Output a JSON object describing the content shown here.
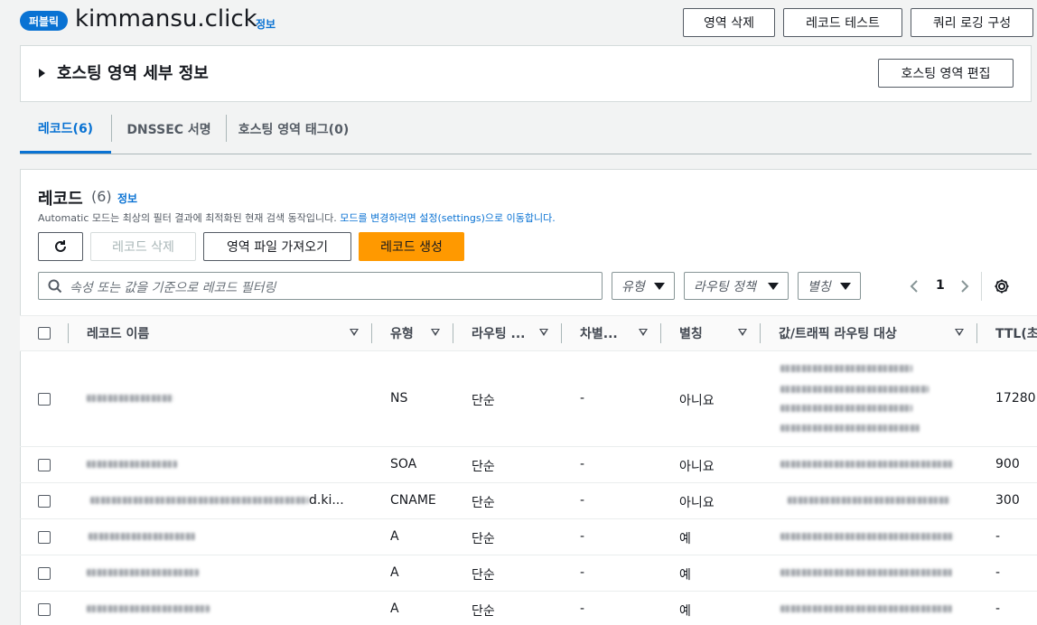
{
  "header": {
    "badge": "퍼블릭",
    "title": "kimmansu.click",
    "info": "정보",
    "buttons": [
      "영역 삭제",
      "레코드 테스트",
      "쿼리 로깅 구성"
    ]
  },
  "details": {
    "title": "호스팅 영역 세부 정보",
    "edit_button": "호스팅 영역 편집"
  },
  "tabs": [
    {
      "label": "레코드(6)",
      "active": true
    },
    {
      "label": "DNSSEC 서명",
      "active": false
    },
    {
      "label": "호스팅 영역 태그(0)",
      "active": false
    }
  ],
  "records": {
    "title": "레코드",
    "count": "(6)",
    "info": "정보",
    "desc_plain": "Automatic 모드는 최상의 필터 결과에 최적화된 현재 검색 동작입니다.",
    "desc_link": "모드를 변경하려면 설정(settings)으로 이동합니다.",
    "buttons": {
      "delete": "레코드 삭제",
      "import": "영역 파일 가져오기",
      "create": "레코드 생성"
    },
    "search_placeholder": "속성 또는 값을 기준으로 레코드 필터링",
    "filters": [
      "유형",
      "라우팅 정책",
      "별칭"
    ],
    "page": "1",
    "columns": [
      "레코드 이름",
      "유형",
      "라우팅 ...",
      "차별...",
      "별칭",
      "값/트래픽 라우팅 대상",
      "TTL(초"
    ],
    "rows": [
      {
        "name": "",
        "type": "NS",
        "routing": "단순",
        "diff": "-",
        "alias": "아니요",
        "ttl": "17280"
      },
      {
        "name": "",
        "type": "SOA",
        "routing": "단순",
        "diff": "-",
        "alias": "아니요",
        "ttl": "900"
      },
      {
        "name": "d.ki...",
        "type": "CNAME",
        "routing": "단순",
        "diff": "-",
        "alias": "아니요",
        "ttl": "300"
      },
      {
        "name": "",
        "type": "A",
        "routing": "단순",
        "diff": "-",
        "alias": "예",
        "ttl": "-"
      },
      {
        "name": "",
        "type": "A",
        "routing": "단순",
        "diff": "-",
        "alias": "예",
        "ttl": "-"
      },
      {
        "name": "",
        "type": "A",
        "routing": "단순",
        "diff": "-",
        "alias": "예",
        "ttl": "-"
      }
    ]
  },
  "icons": [
    "refresh-icon",
    "search-icon",
    "chevron-left-icon",
    "chevron-right-icon",
    "gear-icon",
    "caret-right-icon",
    "caret-down-icon"
  ],
  "colors": {
    "accent": "#0972d3",
    "primary_button": "#ff9900",
    "badge": "#0972d3"
  }
}
